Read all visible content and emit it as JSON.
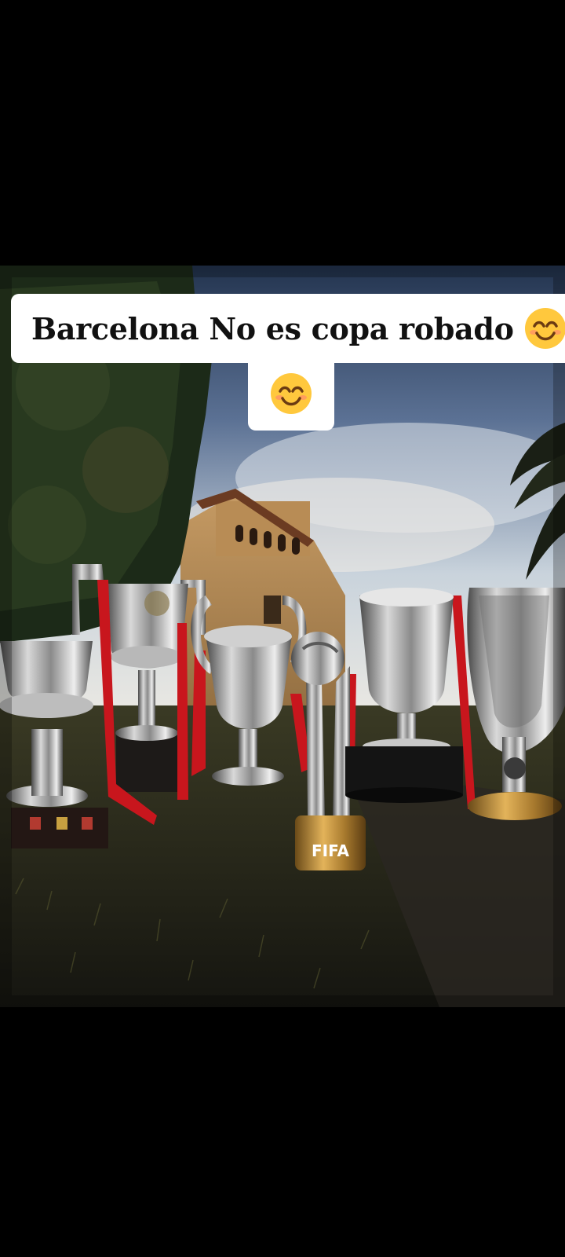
{
  "caption": {
    "line1_text": "Barcelona No es copa robado",
    "emoji_name": "smiling-face-with-smiling-eyes"
  },
  "photo": {
    "subject": "trophies",
    "fifa_base_text": "FIFA"
  },
  "colors": {
    "background": "#000000",
    "caption_bg": "#ffffff",
    "caption_text": "#111111",
    "ribbon_red": "#c8161d",
    "emoji_yellow": "#ffc83d"
  }
}
